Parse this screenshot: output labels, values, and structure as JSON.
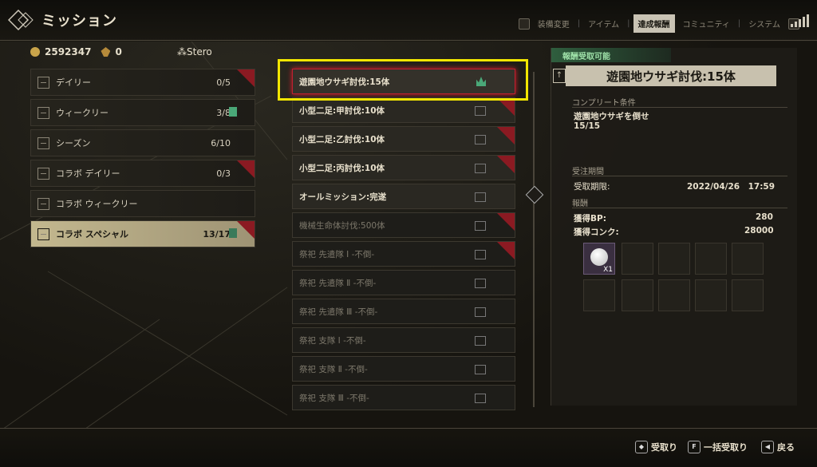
{
  "header": {
    "title": "ミッション",
    "tabs": [
      "装備変更",
      "アイテム",
      "達成報酬",
      "コミュニティ",
      "システム"
    ],
    "active_tab": "達成報酬"
  },
  "status": {
    "coins": "2592347",
    "bp": "0",
    "player_name": "Stero"
  },
  "categories": [
    {
      "label": "デイリー",
      "progress": "0/5"
    },
    {
      "label": "ウィークリー",
      "progress": "3/8"
    },
    {
      "label": "シーズン",
      "progress": "6/10"
    },
    {
      "label": "コラボ デイリー",
      "progress": "0/3"
    },
    {
      "label": "コラボ ウィークリー",
      "progress": ""
    },
    {
      "label": "コラボ スペシャル",
      "progress": "13/17"
    }
  ],
  "missions": [
    {
      "label": "遊園地ウサギ討伐:15体"
    },
    {
      "label": "小型二足:甲討伐:10体"
    },
    {
      "label": "小型二足:乙討伐:10体"
    },
    {
      "label": "小型二足:丙討伐:10体"
    },
    {
      "label": "オールミッション:完遂"
    },
    {
      "label": "機械生命体討伐:500体"
    },
    {
      "label": "祭祀 先遣隊 Ⅰ -不倒-"
    },
    {
      "label": "祭祀 先遣隊 Ⅱ -不倒-"
    },
    {
      "label": "祭祀 先遣隊 Ⅲ -不倒-"
    },
    {
      "label": "祭祀 支隊 Ⅰ -不倒-"
    },
    {
      "label": "祭祀 支隊 Ⅱ -不倒-"
    },
    {
      "label": "祭祀 支隊 Ⅲ -不倒-"
    }
  ],
  "detail": {
    "tag": "報酬受取可能",
    "title": "遊園地ウサギ討伐:15体",
    "complete_label": "コンプリート条件",
    "complete_text": "遊園地ウサギを倒せ",
    "complete_progress": "15/15",
    "period_label": "受注期間",
    "deadline_label": "受取期限:",
    "deadline_value": "2022/04/26　17:59",
    "reward_label": "報酬",
    "bp_label": "獲得BP:",
    "bp_value": "280",
    "coin_label": "獲得コンク:",
    "coin_value": "28000",
    "item_qty": "X1"
  },
  "footer": {
    "receive": "受取り",
    "bulk_receive": "一括受取り",
    "back": "戻る"
  },
  "colors": {
    "accent_red": "#c02030",
    "highlight_yellow": "#f2e600",
    "available_green": "#9ee0a8"
  }
}
